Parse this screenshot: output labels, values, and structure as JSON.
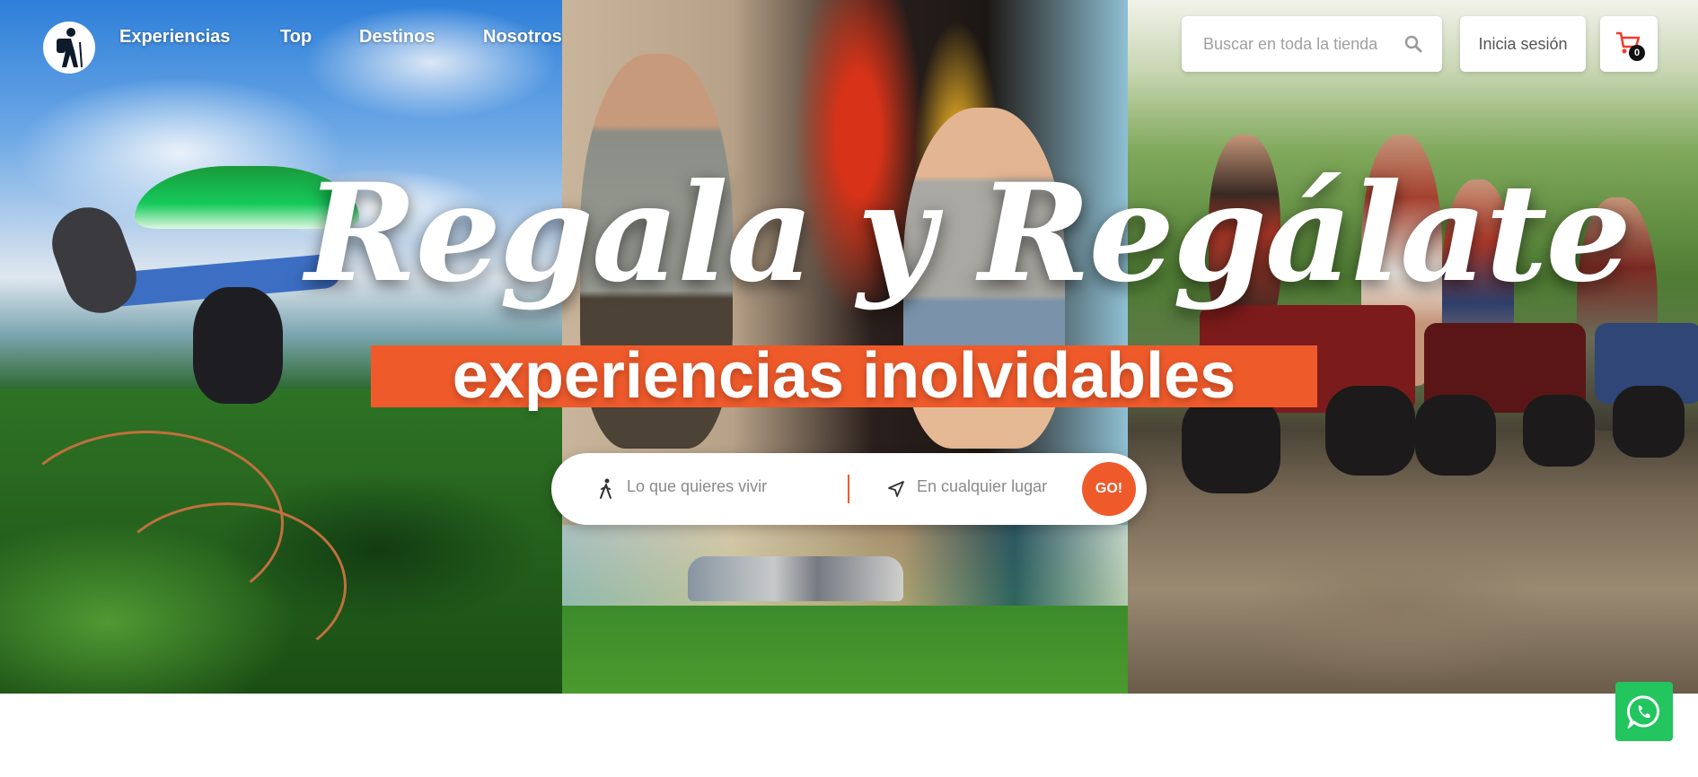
{
  "nav": {
    "links": [
      "Experiencias",
      "Top",
      "Destinos",
      "Nosotros"
    ],
    "search_placeholder": "Buscar en toda la tienda",
    "login_label": "Inicia sesión",
    "cart_count": "0"
  },
  "hero": {
    "headline": "Regala y Regálate",
    "subheadline": "experiencias inolvidables",
    "search": {
      "what_placeholder": "Lo que quieres vivir",
      "where_placeholder": "En cualquier lugar",
      "go_label": "GO!"
    }
  },
  "colors": {
    "accent": "#ef5a2b",
    "whatsapp": "#22c55e",
    "text_light": "#ffffff"
  },
  "icons": [
    "hiker-logo-icon",
    "search-icon",
    "cart-icon",
    "walking-person-icon",
    "send-arrow-icon",
    "whatsapp-icon"
  ]
}
